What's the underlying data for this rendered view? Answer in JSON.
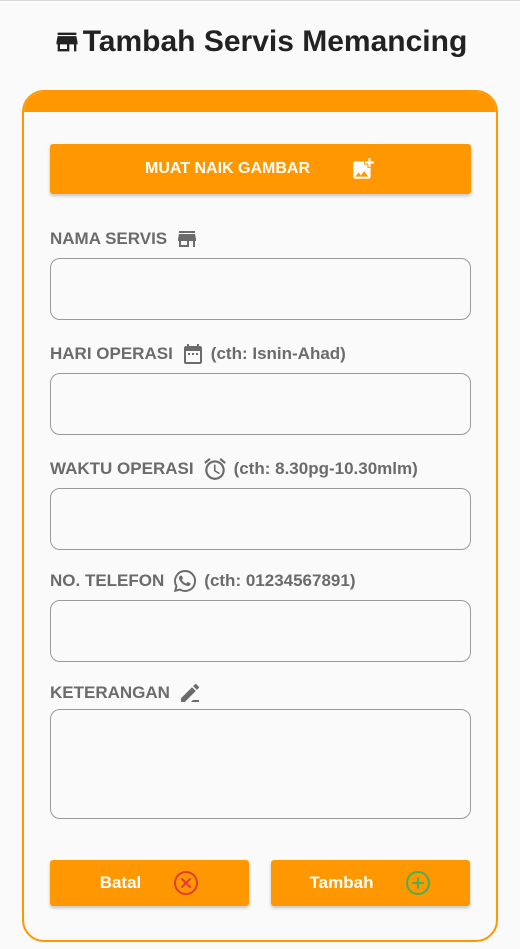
{
  "header": {
    "title": "Tambah Servis Memancing",
    "icon": "store-icon"
  },
  "colors": {
    "accent": "#ff9800",
    "label": "#6b6b6b",
    "cancel_icon": "#e53935",
    "add_icon": "#4caf50"
  },
  "form": {
    "upload_button": {
      "label": "MUAT NAIK GAMBAR",
      "icon": "add-photo-icon"
    },
    "fields": [
      {
        "label": "NAMA SERVIS",
        "hint": "",
        "icon": "store-icon",
        "value": ""
      },
      {
        "label": "HARI OPERASI",
        "hint": "(cth: Isnin-Ahad)",
        "icon": "calendar-icon",
        "value": ""
      },
      {
        "label": "WAKTU OPERASI",
        "hint": "(cth: 8.30pg-10.30mlm)",
        "icon": "alarm-clock-icon",
        "value": ""
      },
      {
        "label": "NO. TELEFON",
        "hint": "(cth: 01234567891)",
        "icon": "whatsapp-icon",
        "value": ""
      },
      {
        "label": "KETERANGAN",
        "hint": "",
        "icon": "edit-pen-icon",
        "value": ""
      }
    ],
    "buttons": {
      "cancel": {
        "label": "Batal",
        "icon": "cancel-circle-icon"
      },
      "add": {
        "label": "Tambah",
        "icon": "add-circle-icon"
      }
    }
  }
}
